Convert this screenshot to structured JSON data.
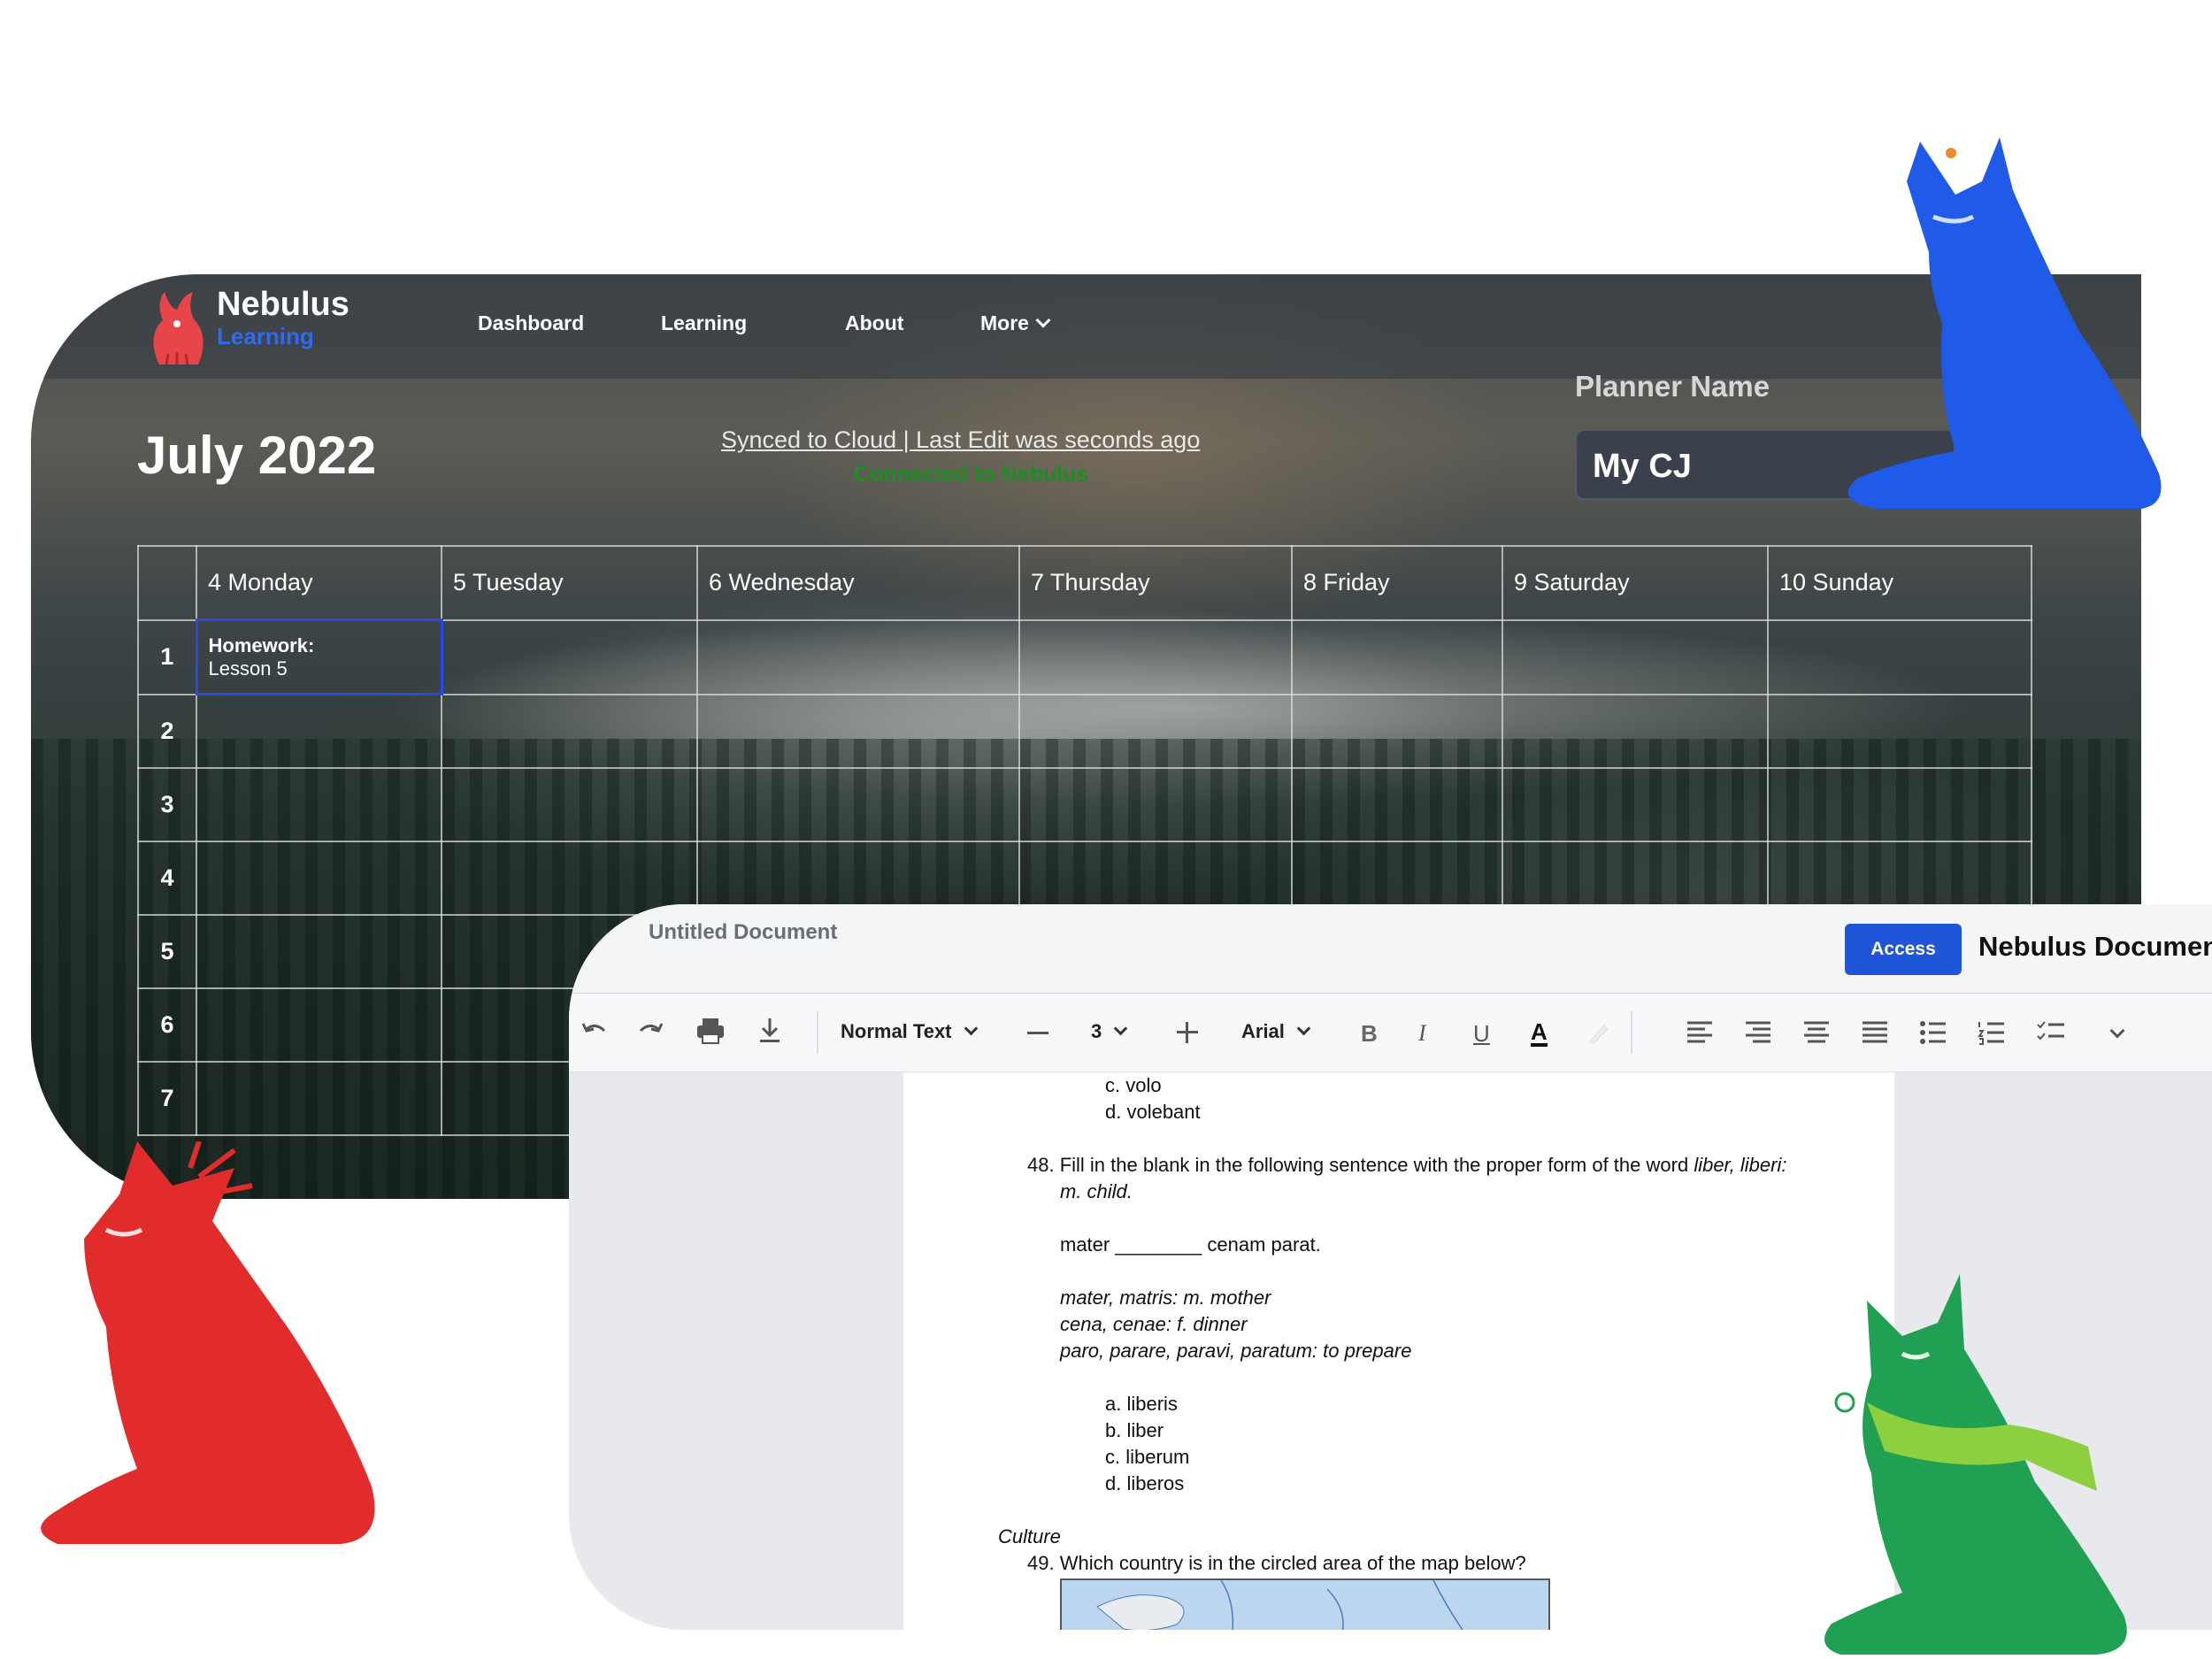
{
  "planner": {
    "brand": {
      "name": "Nebulus",
      "sub": "Learning"
    },
    "nav": [
      {
        "label": "Dashboard"
      },
      {
        "label": "Learning"
      },
      {
        "label": "About"
      },
      {
        "label": "More"
      }
    ],
    "month": "July 2022",
    "sync_status": "Synced to Cloud | Last Edit was seconds ago",
    "connection_status": "Connected to Nebulus",
    "planner_name_label": "Planner Name",
    "planner_name_value": "My CJ",
    "days": [
      "4 Monday",
      "5 Tuesday",
      "6 Wednesday",
      "7 Thursday",
      "8 Friday",
      "9 Saturday",
      "10 Sunday"
    ],
    "rows": [
      "1",
      "2",
      "3",
      "4",
      "5",
      "6",
      "7"
    ],
    "entry": {
      "title": "Homework:",
      "text": "Lesson 5"
    }
  },
  "document": {
    "title": "Untitled Document",
    "access_label": "Access",
    "brand": "Nebulus Documents",
    "toolbar": {
      "style": "Normal Text",
      "size": "3",
      "font": "Arial"
    },
    "lines": {
      "c_prev": "c. volo",
      "d_prev": "d. volebant",
      "q48_a": "48. Fill in the blank in the following sentence with the proper form of the word",
      "q48_word": "liber, liberi:",
      "q48_b": "m. child.",
      "mater_a": "mater",
      "mater_blank": "________",
      "mater_b": "cenam parat.",
      "vocab1": "mater, matris: m. mother",
      "vocab2": "cena, cenae: f. dinner",
      "vocab3": "paro, parare, paravi, paratum: to prepare",
      "a": "a. liberis",
      "b": "b. liber",
      "c": "c. liberum",
      "d": "d. liberos",
      "section": "Culture",
      "q49": "49. Which country is in the circled area of the map below?"
    }
  },
  "colors": {
    "accent": "#1f55d8",
    "brand_blue": "#2f6bf0",
    "connected_green": "#1c8f22",
    "selected_cell": "#2a48e8"
  }
}
